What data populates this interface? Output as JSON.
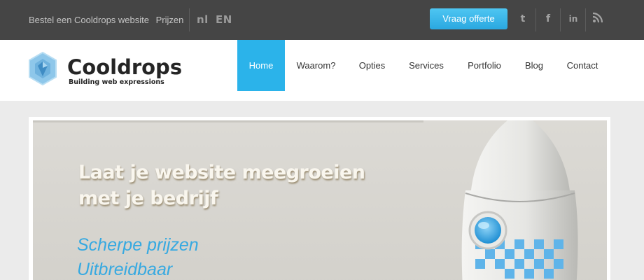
{
  "topbar": {
    "order_link": "Bestel een Cooldrops website",
    "prices_link": "Prijzen",
    "lang_nl": "nl",
    "lang_en": "EN",
    "cta_label": "Vraag offerte",
    "social": [
      "twitter-icon",
      "facebook-icon",
      "linkedin-icon",
      "rss-icon"
    ]
  },
  "brand": {
    "name": "Cooldrops",
    "tagline": "Building web expressions"
  },
  "nav": {
    "items": [
      {
        "label": "Home",
        "active": true
      },
      {
        "label": "Waarom?"
      },
      {
        "label": "Opties"
      },
      {
        "label": "Services"
      },
      {
        "label": "Portfolio"
      },
      {
        "label": "Blog"
      },
      {
        "label": "Contact"
      }
    ]
  },
  "hero": {
    "headline_line1": "Laat je website meegroeien",
    "headline_line2": "met je bedrijf",
    "features": [
      "Scherpe prijzen",
      "Uitbreidbaar"
    ]
  },
  "colors": {
    "accent": "#2bb3ea",
    "topbar": "#454545",
    "feature_text": "#36a9e1"
  }
}
